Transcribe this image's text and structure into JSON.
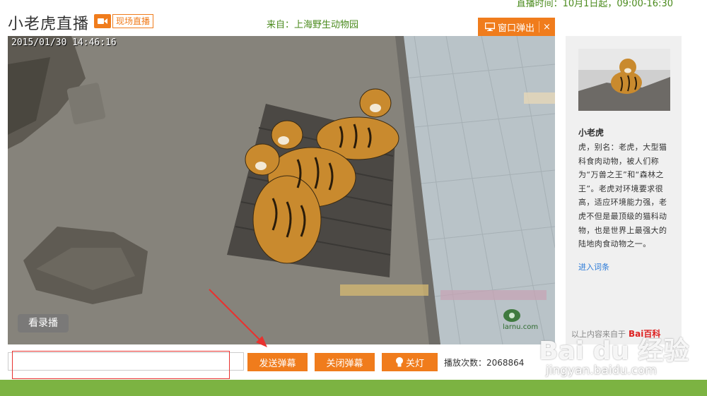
{
  "header": {
    "time_note": "直播时间：10月1日起，09:00-16:30",
    "title": "小老虎直播",
    "live_label": "现场直播",
    "source": "来自：上海野生动物园",
    "popout_label": "窗口弹出",
    "popout_close": "×"
  },
  "video": {
    "timestamp": "2015/01/30 14:46:16",
    "replay_label": "看录播",
    "watermark": "larnu.com"
  },
  "sidebar": {
    "animal_name": "小老虎",
    "description": "虎，别名：老虎，大型猫科食肉动物，被人们称为“万兽之王”和“森林之王”。老虎对环境要求很高，适应环境能力强，老虎不但是最顶级的猫科动物，也是世界上最强大的陆地肉食动物之一。",
    "more_link": "进入词条",
    "credit_prefix": "以上内容来自于",
    "credit_brand": "Bai百科"
  },
  "controls": {
    "input_placeholder": "",
    "send_label": "发送弹幕",
    "close_danmu_label": "关闭弹幕",
    "light_label": "关灯",
    "play_count_label": "播放次数：2068864"
  },
  "overlay": {
    "brand": "Bai du 经验",
    "url": "jingyan.baidu.com"
  },
  "colors": {
    "accent": "#f07c1c",
    "green": "#7cb342",
    "annotation_red": "#e8322f"
  }
}
